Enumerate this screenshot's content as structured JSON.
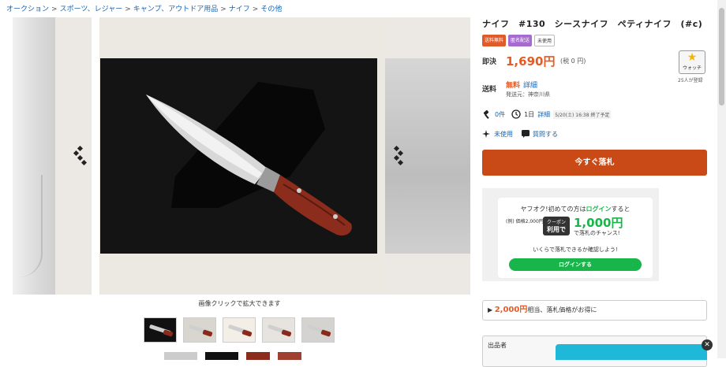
{
  "breadcrumb": [
    "オークション",
    "スポーツ、レジャー",
    "キャンプ、アウトドア用品",
    "ナイフ",
    "その他"
  ],
  "gallery": {
    "caption": "画像クリックで拡大できます"
  },
  "item": {
    "title": "ナイフ　#130　シースナイフ　ペティナイフ　(#c)",
    "badges": [
      "送料無料",
      "匿名配送",
      "未使用"
    ],
    "price_label": "即決",
    "price": "1,690円",
    "tax": "(税 0 円)",
    "shipping_label": "送料",
    "shipping_value": "無料",
    "shipping_detail": "詳細",
    "origin": "発送元：神奈川県",
    "bids": "0件",
    "time_left": "1日",
    "time_detail": "詳細",
    "end_time": "5/20(土) 16:38 終了予定",
    "condition_link": "未使用",
    "question_link": "質問する",
    "bid_button": "今すぐ落札"
  },
  "watch": {
    "label": "ウォッチ",
    "count": "25人が登録"
  },
  "promo": {
    "line1_prefix": "ヤフオク!初めての方は",
    "line1_link": "ログイン",
    "line1_suffix": "すると",
    "line2": "(例) 価格2,000円",
    "coupon_top": "クーポン",
    "coupon_bottom": "利用で",
    "amount": "1,000円",
    "chance": "で落札のチャンス!",
    "check": "いくらで落札できるか確認しよう!",
    "login_button": "ログインする"
  },
  "deal": {
    "amount": "2,000円",
    "text": "相当、落札価格がお得に"
  },
  "seller": {
    "label": "出品者"
  },
  "colors": {
    "accent": "#e75a24",
    "link": "#1565b6",
    "bid_button": "#c94a17",
    "promo_green": "#18b64a"
  }
}
